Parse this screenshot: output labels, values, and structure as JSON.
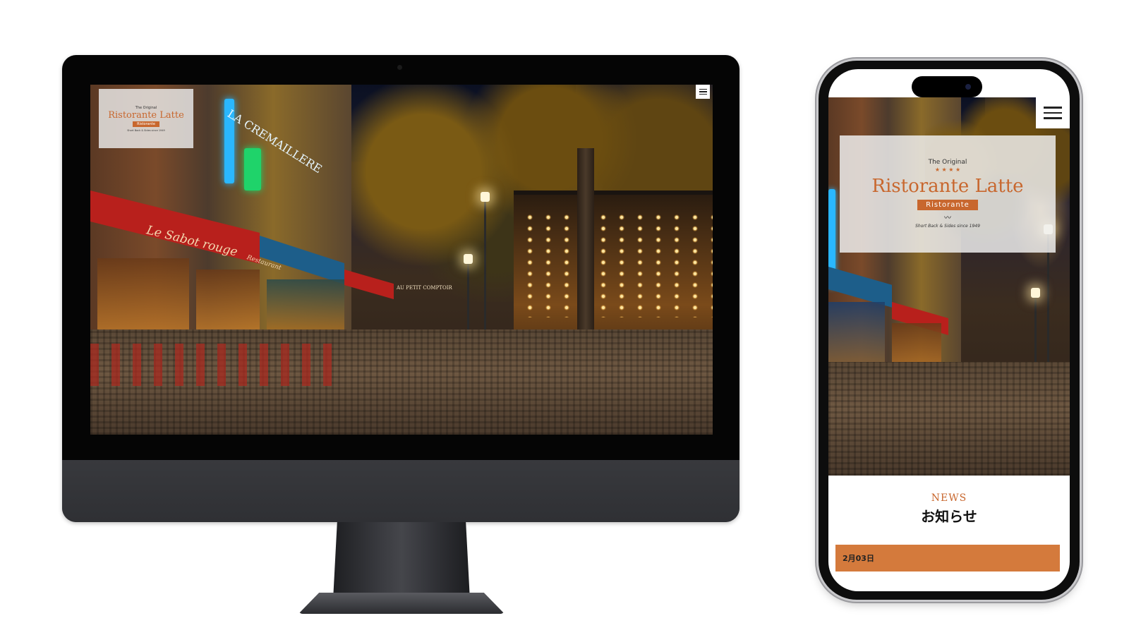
{
  "brand": {
    "tag": "The Original",
    "name": "Ristorante Latte",
    "ribbon": "Ristorante",
    "motto": "Short Back & Sides since 1949"
  },
  "scene": {
    "sign_1": "Le Sabot rouge",
    "sign_2": "LA CREMAILLERE",
    "sign_3": "Restaurant",
    "sign_4": "AU PETIT COMPTOIR"
  },
  "news": {
    "label": "NEWS",
    "title": "お知らせ",
    "item_date": "2月03日"
  },
  "colors": {
    "accent": "#c8672e",
    "news_bar": "#d47a3c"
  },
  "icons": {
    "menu": "hamburger-menu-icon"
  }
}
